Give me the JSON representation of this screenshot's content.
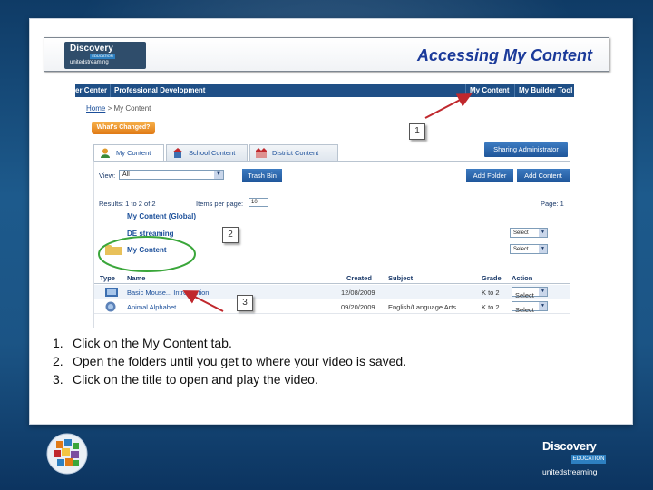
{
  "slide": {
    "title": "Accessing My Content",
    "logo_small": {
      "line1": "Discovery",
      "line2": "EDUCATION",
      "line3": "unitedstreaming"
    }
  },
  "app": {
    "topnav": {
      "left_item_1": "er Center",
      "left_item_2": "Professional Development",
      "right_item_1": "My Content",
      "right_item_2": "My Builder Tool"
    },
    "breadcrumb": {
      "home": "Home",
      "separator": " > ",
      "current": "My Content"
    },
    "whats_changed": "What's Changed?",
    "tabs": [
      {
        "label": "My Content",
        "icon": "person-icon"
      },
      {
        "label": "School Content",
        "icon": "school-icon"
      },
      {
        "label": "District Content",
        "icon": "district-icon"
      }
    ],
    "sharing_admin": "Sharing Administrator",
    "view_label": "View:",
    "view_value": "All",
    "trash_bin": "Trash Bin",
    "add_folder": "Add Folder",
    "add_content": "Add Content",
    "results": "Results: 1 to 2 of 2",
    "items_per_page_label": "Items per page:",
    "items_per_page_value": "10",
    "page": "Page: 1",
    "folders": [
      {
        "name": "My Content (Global)"
      },
      {
        "name": "DE streaming",
        "action": "Select"
      },
      {
        "name": "My Content",
        "action": "Select"
      }
    ],
    "columns": [
      "Type",
      "Name",
      "Created",
      "Subject",
      "Grade",
      "Action"
    ],
    "rows": [
      {
        "name": "Basic Mouse... Introduction",
        "created": "12/08/2009",
        "subject": "",
        "grade": "K to 2",
        "action": "Select"
      },
      {
        "name": "Animal Alphabet",
        "created": "09/20/2009",
        "subject": "English/Language Arts",
        "grade": "K to 2",
        "action": "Select"
      }
    ]
  },
  "callouts": [
    "1",
    "2",
    "3"
  ],
  "instructions": [
    {
      "num": "1.",
      "text": "Click on the My Content tab."
    },
    {
      "num": "2.",
      "text": "Open the folders until you get to where your video is saved."
    },
    {
      "num": "3.",
      "text": "Click on the title to open and play the video."
    }
  ],
  "brand": {
    "line1": "Discovery",
    "line2": "EDUCATION",
    "line3": "unitedstreaming"
  },
  "colors": {
    "accent": "#1b3a9a",
    "nav": "#1f4f86",
    "highlight_circle": "#3aa63a",
    "arrow": "#c0282d"
  }
}
